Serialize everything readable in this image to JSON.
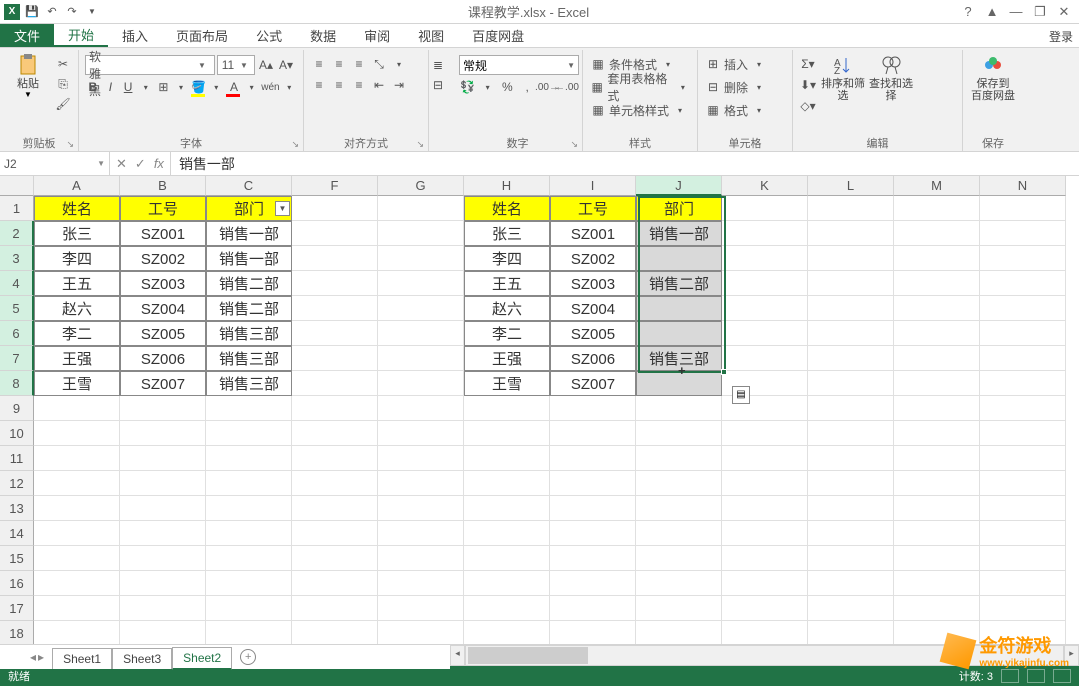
{
  "titlebar": {
    "title": "课程教学.xlsx - Excel",
    "help": "?",
    "min": "—",
    "restore": "❐",
    "close": "✕",
    "ribmin": "▲"
  },
  "qat": {
    "excel": "X",
    "save": "💾",
    "undo": "↶",
    "redo": "↷"
  },
  "tabs": {
    "file": "文件",
    "home": "开始",
    "insert": "插入",
    "layout": "页面布局",
    "formula": "公式",
    "data": "数据",
    "review": "审阅",
    "view": "视图",
    "baidu": "百度网盘",
    "login": "登录"
  },
  "ribbon": {
    "clipboard": {
      "label": "剪贴板",
      "paste": "粘贴"
    },
    "font": {
      "label": "字体",
      "name": "微软雅黑",
      "size": "11"
    },
    "align": {
      "label": "对齐方式",
      "wrap": "自动换行",
      "merge": "合并后居中"
    },
    "number": {
      "label": "数字",
      "format": "常规"
    },
    "styles": {
      "label": "样式",
      "cond": "条件格式",
      "table": "套用表格格式",
      "cell": "单元格样式"
    },
    "cells": {
      "label": "单元格",
      "insert": "插入",
      "delete": "删除",
      "format": "格式"
    },
    "edit": {
      "label": "编辑",
      "sort": "排序和筛选",
      "find": "查找和选择"
    },
    "save": {
      "label": "保存",
      "baidu": "保存到\n百度网盘"
    }
  },
  "fbar": {
    "ref": "J2",
    "fx": "fx",
    "value": "销售一部"
  },
  "grid": {
    "cols": [
      "A",
      "B",
      "C",
      "F",
      "G",
      "H",
      "I",
      "J",
      "K",
      "L",
      "M",
      "N"
    ],
    "rows": [
      1,
      2,
      3,
      4,
      5,
      6,
      7,
      8,
      9,
      10,
      11,
      12,
      13,
      14,
      15,
      16,
      17,
      18
    ],
    "activeCol": "J",
    "activeRow": 2,
    "left": {
      "headers": [
        "姓名",
        "工号",
        "部门"
      ],
      "data": [
        [
          "张三",
          "SZ001",
          "销售一部"
        ],
        [
          "李四",
          "SZ002",
          "销售一部"
        ],
        [
          "王五",
          "SZ003",
          "销售二部"
        ],
        [
          "赵六",
          "SZ004",
          "销售二部"
        ],
        [
          "李二",
          "SZ005",
          "销售三部"
        ],
        [
          "王强",
          "SZ006",
          "销售三部"
        ],
        [
          "王雪",
          "SZ007",
          "销售三部"
        ]
      ]
    },
    "right": {
      "headers": [
        "姓名",
        "工号",
        "部门"
      ],
      "data": [
        [
          "张三",
          "SZ001",
          "销售一部"
        ],
        [
          "李四",
          "SZ002",
          ""
        ],
        [
          "王五",
          "SZ003",
          "销售二部"
        ],
        [
          "赵六",
          "SZ004",
          ""
        ],
        [
          "李二",
          "SZ005",
          ""
        ],
        [
          "王强",
          "SZ006",
          "销售三部"
        ],
        [
          "王雪",
          "SZ007",
          ""
        ]
      ]
    }
  },
  "sheets": {
    "s1": "Sheet1",
    "s2": "Sheet3",
    "s3": "Sheet2"
  },
  "status": {
    "ready": "就绪",
    "count_lbl": "计数:",
    "count_val": "3"
  },
  "watermark": {
    "brand": "金符游戏",
    "url": "www.yikajinfu.com"
  }
}
